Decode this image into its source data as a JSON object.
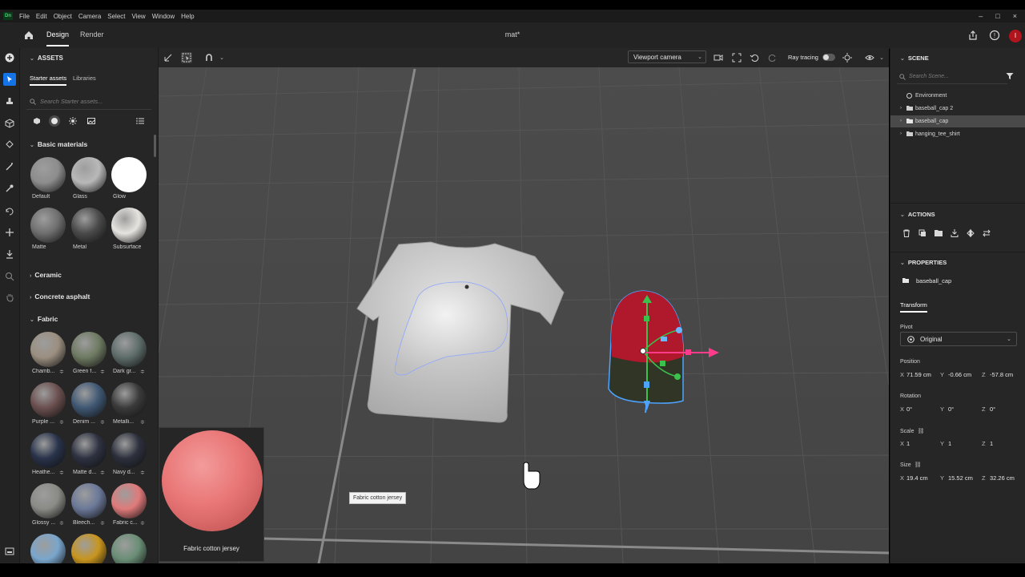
{
  "menubar": {
    "logo": "Dn",
    "items": [
      "File",
      "Edit",
      "Object",
      "Camera",
      "Select",
      "View",
      "Window",
      "Help"
    ],
    "window_controls": [
      "–",
      "□",
      "×"
    ]
  },
  "header": {
    "tabs": [
      "Design",
      "Render"
    ],
    "active_tab": "Design",
    "document_title": "mat*",
    "avatar_letter": "I"
  },
  "assets": {
    "title": "ASSETS",
    "sub_tabs": [
      "Starter assets",
      "Libraries"
    ],
    "search_placeholder": "Search Starter assets...",
    "categories": [
      {
        "name": "Basic materials",
        "expanded": true
      },
      {
        "name": "Ceramic",
        "expanded": false
      },
      {
        "name": "Concrete asphalt",
        "expanded": false
      },
      {
        "name": "Fabric",
        "expanded": true
      }
    ],
    "basic_materials": [
      {
        "label": "Default",
        "color": "#8d8d8d"
      },
      {
        "label": "Glass",
        "color": "#b8b8b8"
      },
      {
        "label": "Glow",
        "color": "#ffffff"
      },
      {
        "label": "Matte",
        "color": "#6f6f6f"
      },
      {
        "label": "Metal",
        "color": "#4a4a4a"
      },
      {
        "label": "Subsurface",
        "color": "#e6e4e0"
      }
    ],
    "fabric_materials": [
      {
        "label": "Chamb...",
        "color": "#9b8f80"
      },
      {
        "label": "Green f...",
        "color": "#6e7a62"
      },
      {
        "label": "Dark gr...",
        "color": "#5e6d6a"
      },
      {
        "label": "Purple ...",
        "color": "#6b4f4f"
      },
      {
        "label": "Denim ...",
        "color": "#3f5773"
      },
      {
        "label": "Metalli...",
        "color": "#3a3a3a"
      },
      {
        "label": "Heathe...",
        "color": "#28324a"
      },
      {
        "label": "Matte d...",
        "color": "#2d3140"
      },
      {
        "label": "Navy d...",
        "color": "#2c303c"
      },
      {
        "label": "Glossy ...",
        "color": "#8a8a86"
      },
      {
        "label": "Bleech...",
        "color": "#6b7898"
      },
      {
        "label": "Fabric c...",
        "color": "#e07a7a"
      },
      {
        "label": "",
        "color": "#7aa6cc"
      },
      {
        "label": "",
        "color": "#c8951e"
      },
      {
        "label": "",
        "color": "#6a8e76"
      }
    ]
  },
  "viewport": {
    "camera_select": "Viewport camera",
    "ray_tracing_label": "Ray tracing",
    "ray_tracing_on": false,
    "tooltip": "Fabric cotton jersey",
    "hover_preview_label": "Fabric cotton jersey"
  },
  "scene": {
    "title": "SCENE",
    "search_placeholder": "Search Scene...",
    "items": [
      {
        "label": "Environment",
        "selected": false,
        "has_children": false
      },
      {
        "label": "baseball_cap 2",
        "selected": false,
        "has_children": true
      },
      {
        "label": "baseball_cap",
        "selected": true,
        "has_children": true
      },
      {
        "label": "hanging_tee_shirt",
        "selected": false,
        "has_children": true
      }
    ]
  },
  "actions": {
    "title": "ACTIONS"
  },
  "properties": {
    "title": "PROPERTIES",
    "object_name": "baseball_cap",
    "tab": "Transform",
    "pivot_label": "Pivot",
    "pivot_value": "Original",
    "position_label": "Position",
    "position": {
      "x": "71.59 cm",
      "y": "-0.66 cm",
      "z": "-57.8 cm"
    },
    "rotation_label": "Rotation",
    "rotation": {
      "x": "0°",
      "y": "0°",
      "z": "0°"
    },
    "scale_label": "Scale",
    "scale": {
      "x": "1",
      "y": "1",
      "z": "1"
    },
    "size_label": "Size",
    "size": {
      "x": "19.4 cm",
      "y": "15.52 cm",
      "z": "32.26 cm"
    }
  }
}
